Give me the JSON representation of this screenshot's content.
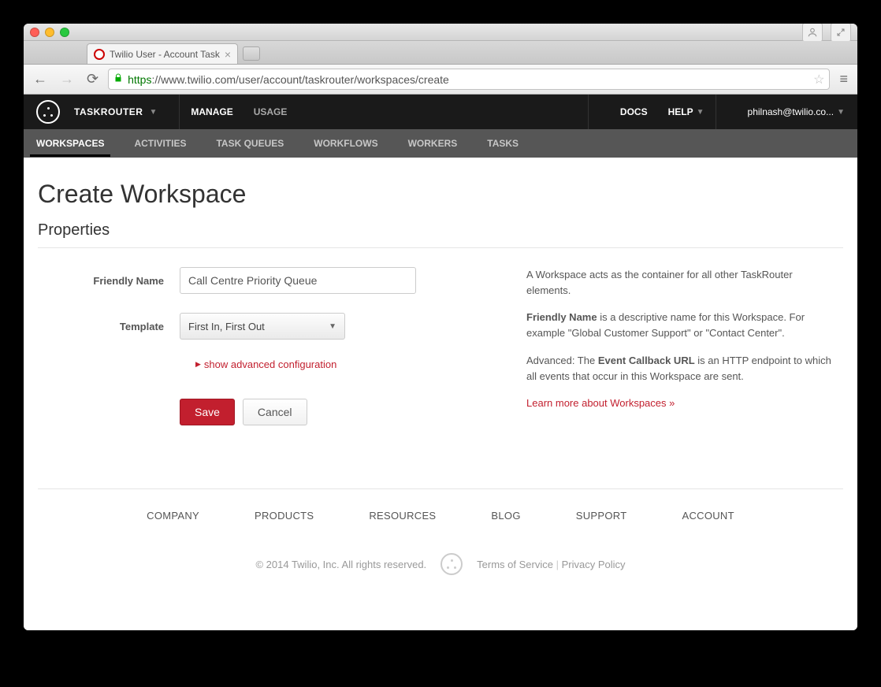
{
  "browser": {
    "tab_title": "Twilio User - Account Task",
    "url_scheme": "https",
    "url_rest": "://www.twilio.com/user/account/taskrouter/workspaces/create"
  },
  "topbar": {
    "brand": "TASKROUTER",
    "items": [
      "MANAGE",
      "USAGE"
    ],
    "active_item": "MANAGE",
    "docs": "DOCS",
    "help": "HELP",
    "account": "philnash@twilio.co..."
  },
  "subnav": {
    "items": [
      "WORKSPACES",
      "ACTIVITIES",
      "TASK QUEUES",
      "WORKFLOWS",
      "WORKERS",
      "TASKS"
    ],
    "active": "WORKSPACES"
  },
  "page": {
    "title": "Create Workspace",
    "section": "Properties"
  },
  "form": {
    "friendly_name_label": "Friendly Name",
    "friendly_name_value": "Call Centre Priority Queue",
    "template_label": "Template",
    "template_value": "First In, First Out",
    "advanced_toggle": "show advanced configuration",
    "save": "Save",
    "cancel": "Cancel"
  },
  "help": {
    "p1": "A Workspace acts as the container for all other TaskRouter elements.",
    "p2_pre": "",
    "p2_bold": "Friendly Name",
    "p2_rest": " is a descriptive name for this Workspace. For example \"Global Customer Support\" or \"Contact Center\".",
    "p3_pre": "Advanced: The ",
    "p3_bold": "Event Callback URL",
    "p3_rest": " is an HTTP endpoint to which all events that occur in this Workspace are sent.",
    "learn_more": "Learn more about Workspaces »"
  },
  "footer": {
    "links": [
      "COMPANY",
      "PRODUCTS",
      "RESOURCES",
      "BLOG",
      "SUPPORT",
      "ACCOUNT"
    ],
    "copyright": "© 2014 Twilio, Inc. All rights reserved.",
    "tos": "Terms of Service",
    "privacy": "Privacy Policy"
  }
}
